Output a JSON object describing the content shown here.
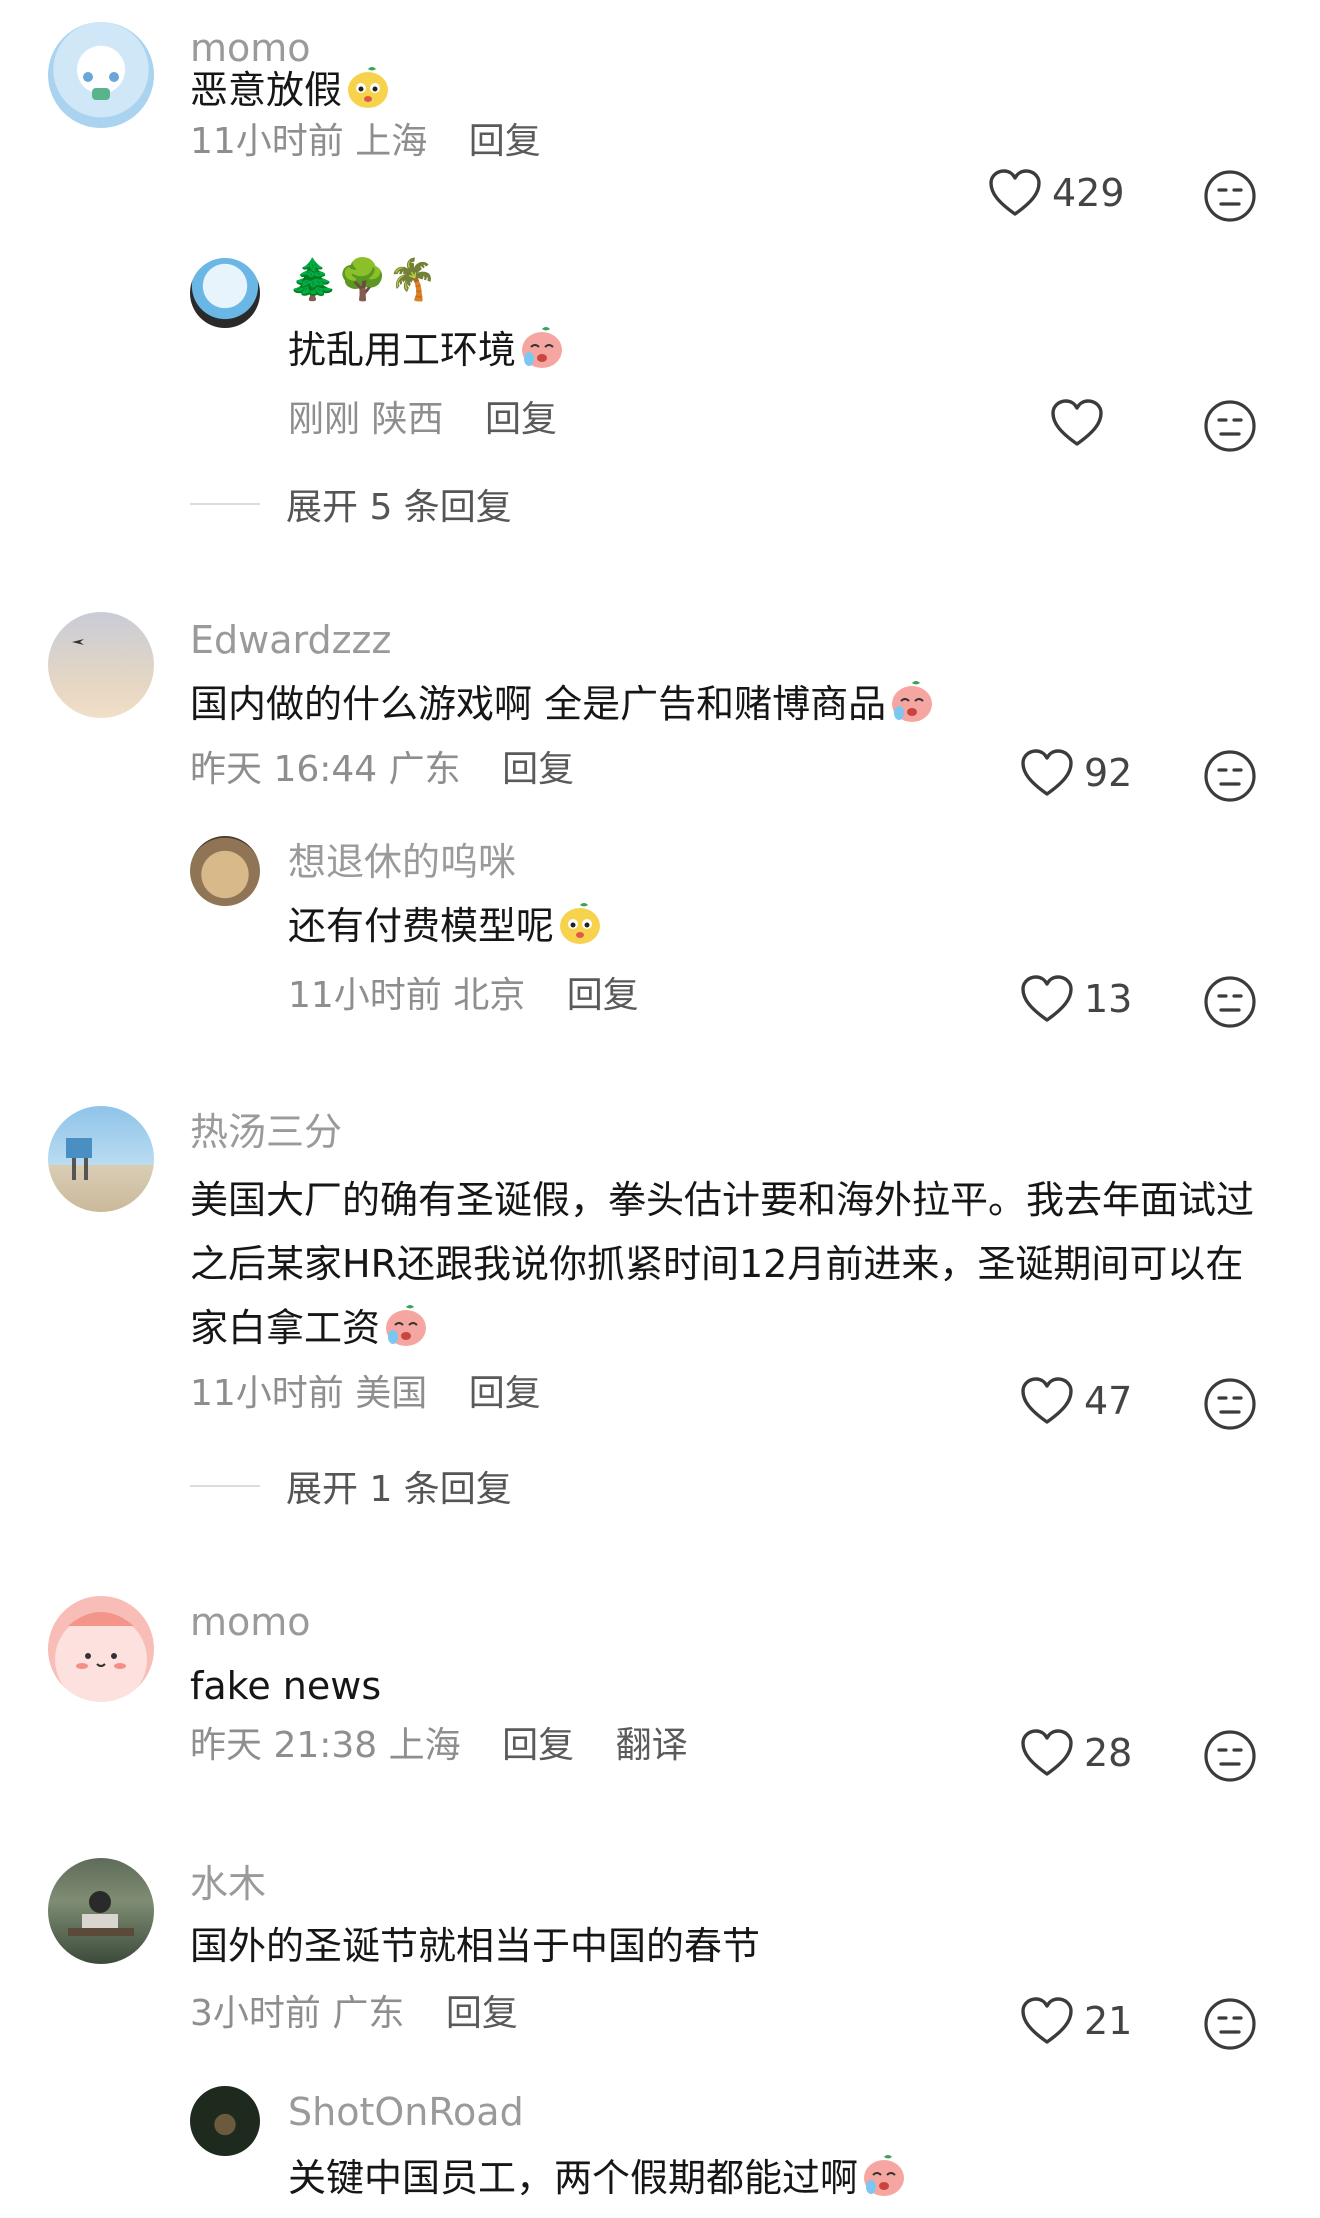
{
  "comments": [
    {
      "username": "momo",
      "text": "恶意放假",
      "time": "11小时前",
      "location": "上海",
      "reply_label": "回复",
      "likes": "429",
      "replies": [
        {
          "username_emoji": "🌲🌳🌴",
          "text": "扰乱用工环境",
          "time": "刚刚",
          "location": "陕西",
          "reply_label": "回复",
          "likes": ""
        }
      ],
      "expand_label": "展开 5 条回复"
    },
    {
      "username": "Edwardzzz",
      "text": "国内做的什么游戏啊 全是广告和赌博商品",
      "time": "昨天 16:44",
      "location": "广东",
      "reply_label": "回复",
      "likes": "92",
      "replies": [
        {
          "username": "想退休的呜咪",
          "text": "还有付费模型呢",
          "time": "11小时前",
          "location": "北京",
          "reply_label": "回复",
          "likes": "13"
        }
      ]
    },
    {
      "username": "热汤三分",
      "text": "美国大厂的确有圣诞假，拳头估计要和海外拉平。我去年面试过之后某家HR还跟我说你抓紧时间12月前进来，圣诞期间可以在家白拿工资",
      "time": "11小时前",
      "location": "美国",
      "reply_label": "回复",
      "likes": "47",
      "expand_label": "展开 1 条回复"
    },
    {
      "username": "momo",
      "text": "fake news",
      "time": "昨天 21:38",
      "location": "上海",
      "reply_label": "回复",
      "translate_label": "翻译",
      "likes": "28"
    },
    {
      "username": "水木",
      "text": "国外的圣诞节就相当于中国的春节",
      "time": "3小时前",
      "location": "广东",
      "reply_label": "回复",
      "likes": "21",
      "replies": [
        {
          "username": "ShotOnRoad",
          "text": "关键中国员工，两个假期都能过啊"
        }
      ]
    }
  ],
  "icons": {
    "like": "heart-outline-icon",
    "react": "neutral-face-icon"
  },
  "colors": {
    "username": "#9a9a9a",
    "text": "#161616",
    "meta": "#8e8e8e"
  }
}
